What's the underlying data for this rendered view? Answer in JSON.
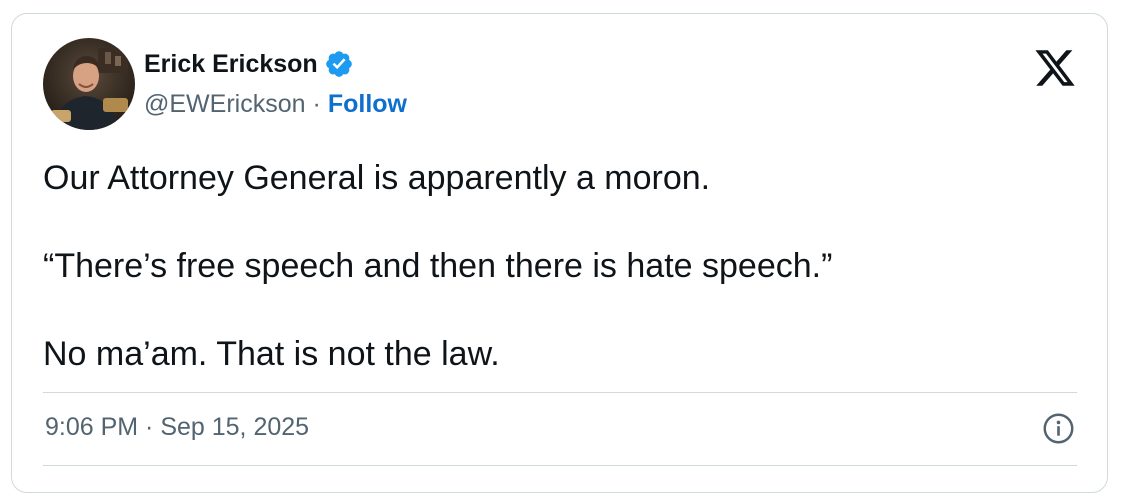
{
  "tweet": {
    "author": {
      "display_name": "Erick Erickson",
      "handle": "@EWErickson",
      "verified": true,
      "avatar_icon": "user-photo-avatar"
    },
    "separator": "·",
    "follow_label": "Follow",
    "paragraphs": [
      "Our Attorney General is apparently a moron.",
      "“There’s free speech and then there is hate speech.”",
      "No ma’am.  That is not the law."
    ],
    "timestamp": "9:06 PM · Sep 15, 2025",
    "platform_icon": "x-logo-icon",
    "info_icon": "info-icon"
  },
  "colors": {
    "text_primary": "#0f1419",
    "text_secondary": "#536471",
    "link_blue": "#0f6fcf",
    "verified_blue": "#1d9bf0",
    "border": "#cfd9de"
  }
}
